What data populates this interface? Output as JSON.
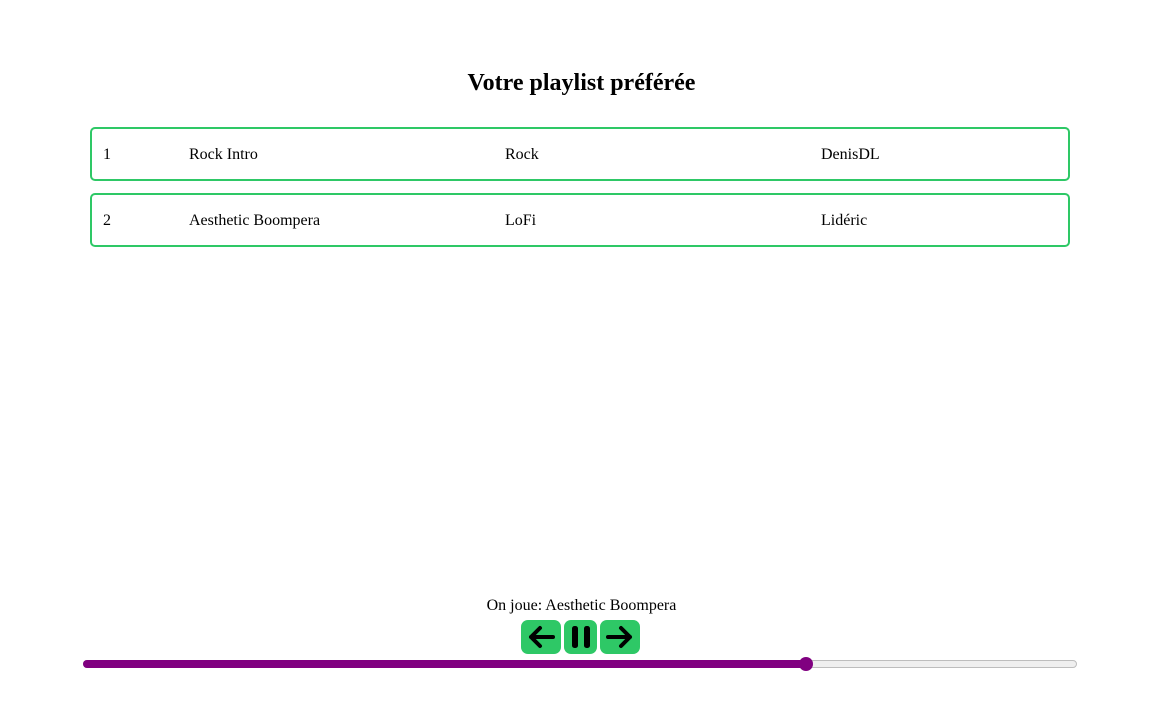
{
  "title": "Votre playlist préférée",
  "tracks": [
    {
      "number": "1",
      "title": "Rock Intro",
      "genre": "Rock",
      "artist": "DenisDL"
    },
    {
      "number": "2",
      "title": "Aesthetic Boompera",
      "genre": "LoFi",
      "artist": "Lidéric"
    }
  ],
  "player": {
    "now_playing": "On joue: Aesthetic Boompera",
    "controls": {
      "previous_icon": "arrow-left-icon",
      "pause_icon": "pause-icon",
      "next_icon": "arrow-right-icon"
    },
    "progress": 0.727
  },
  "colors": {
    "accent": "#2ec866",
    "progress": "#800080"
  }
}
